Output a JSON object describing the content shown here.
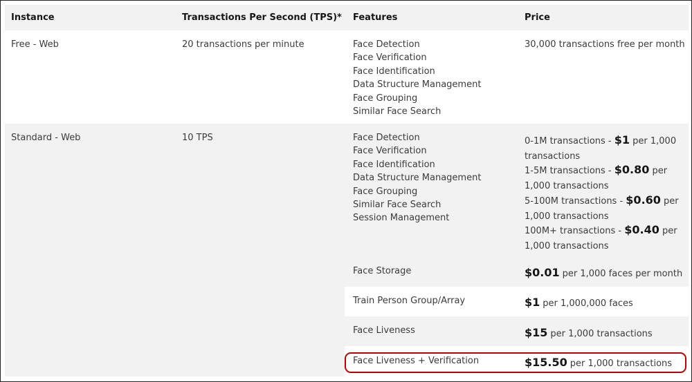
{
  "table": {
    "headers": {
      "instance": "Instance",
      "tps": "Transactions Per Second (TPS)*",
      "features": "Features",
      "price": "Price"
    },
    "rows": [
      {
        "instance": "Free - Web",
        "tps": "20 transactions per minute",
        "features": [
          "Face Detection",
          "Face Verification",
          "Face Identification",
          "Data Structure Management",
          "Face Grouping",
          "Similar Face Search"
        ],
        "price": "30,000 transactions free per month"
      },
      {
        "instance": "Standard - Web",
        "tps": "10 TPS",
        "features": [
          "Face Detection",
          "Face Verification",
          "Face Identification",
          "Data Structure Management",
          "Face Grouping",
          "Similar Face Search",
          "Session Management"
        ],
        "price_tiers": [
          {
            "range": "0-1M transactions - ",
            "amount": "$1",
            "unit": " per 1,000 transactions"
          },
          {
            "range": "1-5M transactions - ",
            "amount": "$0.80",
            "unit": " per 1,000 transactions"
          },
          {
            "range": "5-100M transactions - ",
            "amount": "$0.60",
            "unit": " per 1,000 transactions"
          },
          {
            "range": "100M+ transactions - ",
            "amount": "$0.40",
            "unit": " per 1,000 transactions"
          }
        ]
      }
    ],
    "addons": [
      {
        "feature": "Face Storage",
        "amount": "$0.01",
        "unit": "per 1,000 faces per month"
      },
      {
        "feature": "Train Person Group/Array",
        "amount": "$1",
        "unit": "per 1,000,000 faces"
      },
      {
        "feature": "Face Liveness",
        "amount": "$15",
        "unit": "per 1,000 transactions"
      },
      {
        "feature": "Face Liveness + Verification",
        "amount": "$15.50",
        "unit": "per 1,000 transactions",
        "highlighted": true
      }
    ]
  },
  "colors": {
    "row_grey": "#f2f2f2",
    "text": "#3b3b3b",
    "header_text": "#161616",
    "highlight_border": "#c00000"
  }
}
